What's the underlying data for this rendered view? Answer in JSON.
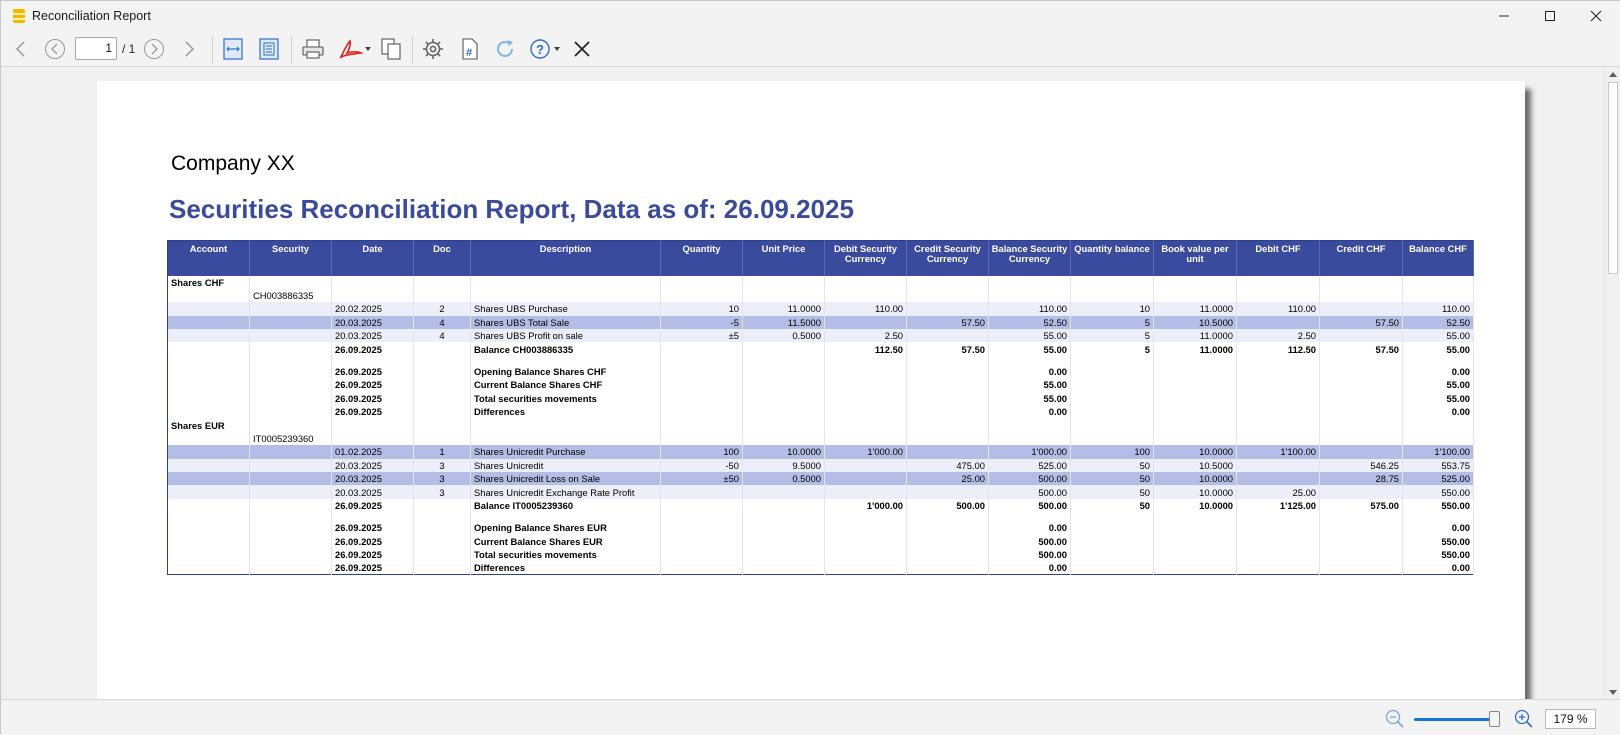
{
  "window": {
    "title": "Reconciliation Report"
  },
  "toolbar": {
    "page_current": "1",
    "page_total": "/ 1"
  },
  "report": {
    "company": "Company XX",
    "title": "Securities Reconciliation Report, Data as of: 26.09.2025",
    "columns": [
      "Account",
      "Security",
      "Date",
      "Doc",
      "Description",
      "Quantity",
      "Unit Price",
      "Debit Security Currency",
      "Credit Security Currency",
      "Balance Security Currency",
      "Quantity balance",
      "Book value per unit",
      "Debit CHF",
      "Credit CHF",
      "Balance CHF"
    ],
    "rows": [
      {
        "style": "lvl bold",
        "cells": [
          "Shares CHF",
          "",
          "",
          "",
          "",
          "",
          "",
          "",
          "",
          "",
          "",
          "",
          "",
          "",
          ""
        ]
      },
      {
        "style": "lvl",
        "cells": [
          "",
          "CH003886335",
          "",
          "",
          "",
          "",
          "",
          "",
          "",
          "",
          "",
          "",
          "",
          "",
          ""
        ]
      },
      {
        "style": "odd",
        "cells": [
          "",
          "",
          "20.02.2025",
          "2",
          "Shares UBS Purchase",
          "10",
          "11.0000",
          "110.00",
          "",
          "110.00",
          "10",
          "11.0000",
          "110.00",
          "",
          "110.00"
        ]
      },
      {
        "style": "hl",
        "cells": [
          "",
          "",
          "20.03.2025",
          "4",
          "Shares UBS Total Sale",
          "-5",
          "11.5000",
          "",
          "57.50",
          "52.50",
          "5",
          "10.5000",
          "",
          "57.50",
          "52.50"
        ]
      },
      {
        "style": "odd",
        "cells": [
          "",
          "",
          "20.03.2025",
          "4",
          "Shares UBS Profit on sale",
          "±5",
          "0.5000",
          "2.50",
          "",
          "55.00",
          "5",
          "11.0000",
          "2.50",
          "",
          "55.00"
        ]
      },
      {
        "style": "lvl bold",
        "cells": [
          "",
          "",
          "26.09.2025",
          "",
          "Balance CH003886335",
          "",
          "",
          "112.50",
          "57.50",
          "55.00",
          "5",
          "11.0000",
          "112.50",
          "57.50",
          "55.00"
        ]
      },
      {
        "style": "lvl sp",
        "cells": [
          "",
          "",
          "",
          "",
          "",
          "",
          "",
          "",
          "",
          "",
          "",
          "",
          "",
          "",
          ""
        ]
      },
      {
        "style": "lvl bold",
        "cells": [
          "",
          "",
          "26.09.2025",
          "",
          "Opening Balance Shares CHF",
          "",
          "",
          "",
          "",
          "0.00",
          "",
          "",
          "",
          "",
          "0.00"
        ]
      },
      {
        "style": "lvl bold",
        "cells": [
          "",
          "",
          "26.09.2025",
          "",
          "Current Balance Shares CHF",
          "",
          "",
          "",
          "",
          "55.00",
          "",
          "",
          "",
          "",
          "55.00"
        ]
      },
      {
        "style": "lvl bold",
        "cells": [
          "",
          "",
          "26.09.2025",
          "",
          "Total securities movements",
          "",
          "",
          "",
          "",
          "55.00",
          "",
          "",
          "",
          "",
          "55.00"
        ]
      },
      {
        "style": "lvl bold",
        "cells": [
          "",
          "",
          "26.09.2025",
          "",
          "Differences",
          "",
          "",
          "",
          "",
          "0.00",
          "",
          "",
          "",
          "",
          "0.00"
        ]
      },
      {
        "style": "lvl bold",
        "cells": [
          "Shares EUR",
          "",
          "",
          "",
          "",
          "",
          "",
          "",
          "",
          "",
          "",
          "",
          "",
          "",
          ""
        ]
      },
      {
        "style": "lvl",
        "cells": [
          "",
          "IT0005239360",
          "",
          "",
          "",
          "",
          "",
          "",
          "",
          "",
          "",
          "",
          "",
          "",
          ""
        ]
      },
      {
        "style": "hl",
        "cells": [
          "",
          "",
          "01.02.2025",
          "1",
          "Shares Unicredit Purchase",
          "100",
          "10.0000",
          "1'000.00",
          "",
          "1'000.00",
          "100",
          "10.0000",
          "1'100.00",
          "",
          "1'100.00"
        ]
      },
      {
        "style": "odd",
        "cells": [
          "",
          "",
          "20.03.2025",
          "3",
          "Shares Unicredit",
          "-50",
          "9.5000",
          "",
          "475.00",
          "525.00",
          "50",
          "10.5000",
          "",
          "546.25",
          "553.75"
        ]
      },
      {
        "style": "hl",
        "cells": [
          "",
          "",
          "20.03.2025",
          "3",
          "Shares Unicredit Loss on Sale",
          "±50",
          "0.5000",
          "",
          "25.00",
          "500.00",
          "50",
          "10.0000",
          "",
          "28.75",
          "525.00"
        ]
      },
      {
        "style": "odd",
        "cells": [
          "",
          "",
          "20.03.2025",
          "3",
          "Shares Unicredit Exchange Rate Profit",
          "",
          "",
          "",
          "",
          "500.00",
          "50",
          "10.0000",
          "25.00",
          "",
          "550.00"
        ]
      },
      {
        "style": "lvl bold",
        "cells": [
          "",
          "",
          "26.09.2025",
          "",
          "Balance IT0005239360",
          "",
          "",
          "1'000.00",
          "500.00",
          "500.00",
          "50",
          "10.0000",
          "1'125.00",
          "575.00",
          "550.00"
        ]
      },
      {
        "style": "lvl sp",
        "cells": [
          "",
          "",
          "",
          "",
          "",
          "",
          "",
          "",
          "",
          "",
          "",
          "",
          "",
          "",
          ""
        ]
      },
      {
        "style": "lvl bold",
        "cells": [
          "",
          "",
          "26.09.2025",
          "",
          "Opening Balance Shares EUR",
          "",
          "",
          "",
          "",
          "0.00",
          "",
          "",
          "",
          "",
          "0.00"
        ]
      },
      {
        "style": "lvl bold",
        "cells": [
          "",
          "",
          "26.09.2025",
          "",
          "Current Balance Shares EUR",
          "",
          "",
          "",
          "",
          "500.00",
          "",
          "",
          "",
          "",
          "550.00"
        ]
      },
      {
        "style": "lvl bold",
        "cells": [
          "",
          "",
          "26.09.2025",
          "",
          "Total securities movements",
          "",
          "",
          "",
          "",
          "500.00",
          "",
          "",
          "",
          "",
          "550.00"
        ]
      },
      {
        "style": "lvl bold",
        "cells": [
          "",
          "",
          "26.09.2025",
          "",
          "Differences",
          "",
          "",
          "",
          "",
          "0.00",
          "",
          "",
          "",
          "",
          "0.00"
        ]
      }
    ]
  },
  "statusbar": {
    "zoom": "179 %",
    "zoom_level_percent": 95
  },
  "colors": {
    "header_bg": "#3a4a9d",
    "title": "#3b4b9b",
    "row_highlight": "#b4bde6",
    "row_alt": "#eceef8"
  },
  "icons": [
    "app-icon",
    "minimize-icon",
    "maximize-icon",
    "close-icon",
    "back-icon",
    "prev-page-icon",
    "next-page-icon",
    "forward-icon",
    "fit-width-icon",
    "fit-page-icon",
    "print-icon",
    "pdf-icon",
    "copy-icon",
    "settings-icon",
    "page-number-icon",
    "refresh-icon",
    "help-icon",
    "close-report-icon",
    "zoom-out-icon",
    "zoom-in-icon"
  ]
}
